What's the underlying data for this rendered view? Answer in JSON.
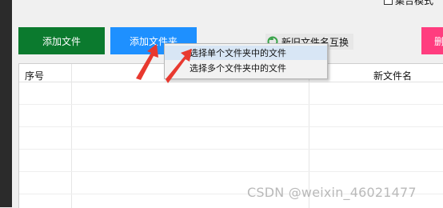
{
  "top": {
    "checkbox_label": "集合模式"
  },
  "toolbar": {
    "add_file_label": "添加文件",
    "add_folder_label": "添加文件夹",
    "swap_label": "新旧文件名互换",
    "pink_label": "删"
  },
  "table": {
    "columns": [
      "序号",
      "新文件名"
    ],
    "rows": []
  },
  "menu": {
    "items": [
      "选择单个文件夹中的文件",
      "选择多个文件夹中的文件"
    ]
  },
  "watermark": "CSDN @weixin_46021477",
  "colors": {
    "add_file_bg": "#0b7a2e",
    "add_folder_bg": "#1e90ff",
    "pink_bg": "#ff3d7f",
    "arrow": "#e8392f"
  }
}
